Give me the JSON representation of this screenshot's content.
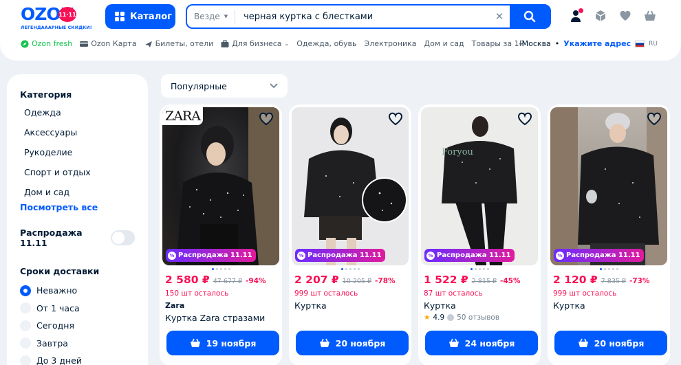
{
  "logo": {
    "name": "OZON",
    "badge": "11·11",
    "tagline": "ЛЕГЕНДАААРНЫЕ СКИДКИ!"
  },
  "header": {
    "catalog_label": "Каталог",
    "search": {
      "scope": "Везде",
      "value": "черная куртка с блестками"
    },
    "icons": [
      "profile-icon",
      "orders-icon",
      "favorites-icon",
      "cart-icon"
    ]
  },
  "nav": {
    "items": [
      "Ozon fresh",
      "Ozon Карта",
      "Билеты, отели",
      "Для бизнеса",
      "Одежда, обувь",
      "Электроника",
      "Дом и сад",
      "Товары за 1₽"
    ],
    "city": "Москва",
    "address_link": "Укажите адрес",
    "lang": "RU"
  },
  "sidebar": {
    "category_title": "Категория",
    "categories": [
      "Одежда",
      "Аксессуары",
      "Рукоделие",
      "Спорт и отдых",
      "Дом и сад"
    ],
    "show_all": "Посмотреть все",
    "sale_toggle_label": "Распродажа 11.11",
    "delivery_title": "Сроки доставки",
    "delivery_options": [
      "Неважно",
      "От 1 часа",
      "Сегодня",
      "Завтра",
      "До 3 дней"
    ],
    "delivery_selected": "Неважно"
  },
  "sort": {
    "selected": "Популярные"
  },
  "products": [
    {
      "badge": "Распродажа 11.11",
      "price": "2 580 ₽",
      "old_price": "47 677 ₽",
      "discount": "-94%",
      "stock": "150 шт осталось",
      "brand": "Zara",
      "name": "Куртка Zara стразами",
      "delivery": "19 ноября",
      "logo_text": "ZARA"
    },
    {
      "badge": "Распродажа 11.11",
      "price": "2 207 ₽",
      "old_price": "10 205 ₽",
      "discount": "-78%",
      "stock": "999 шт осталось",
      "name": "Куртка",
      "delivery": "20 ноября"
    },
    {
      "badge": "Распродажа 11.11",
      "price": "1 522 ₽",
      "old_price": "2 815 ₽",
      "discount": "-45%",
      "stock": "87 шт осталось",
      "name": "Куртка",
      "rating": "4.9",
      "reviews": "50 отзывов",
      "delivery": "24 ноября",
      "watermark": "Foryou"
    },
    {
      "badge": "Распродажа 11.11",
      "price": "2 120 ₽",
      "old_price": "7 835 ₽",
      "discount": "-73%",
      "stock": "999 шт осталось",
      "name": "Куртка",
      "delivery": "20 ноября"
    }
  ],
  "colors": {
    "brand": "#005bff",
    "sale": "#f91155",
    "fresh": "#10c44c"
  }
}
